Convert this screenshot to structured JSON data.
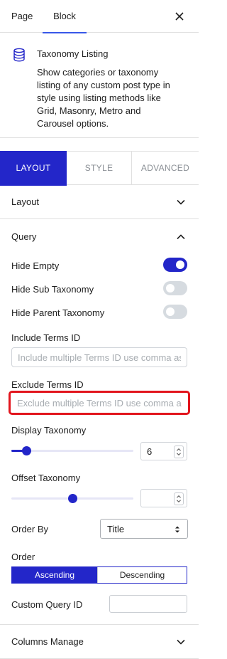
{
  "sidebar_tabs": {
    "page": "Page",
    "block": "Block"
  },
  "block_card": {
    "title": "Taxonomy Listing",
    "description": "Show categories or taxonomy listing of any custom post type in style using listing methods like Grid, Masonry, Metro and Carousel options.",
    "icon": "database-icon"
  },
  "inspector_tabs": {
    "layout": "LAYOUT",
    "style": "STYLE",
    "advanced": "ADVANCED"
  },
  "panels": {
    "layout": "Layout",
    "query": "Query",
    "columns_manage": "Columns Manage"
  },
  "query": {
    "hide_empty": {
      "label": "Hide Empty",
      "enabled": true
    },
    "hide_sub_taxonomy": {
      "label": "Hide Sub Taxonomy",
      "enabled": false
    },
    "hide_parent_taxonomy": {
      "label": "Hide Parent Taxonomy",
      "enabled": false
    },
    "include_terms": {
      "label": "Include Terms ID",
      "placeholder": "Include multiple Terms ID use comma as",
      "value": ""
    },
    "exclude_terms": {
      "label": "Exclude Terms ID",
      "placeholder": "Exclude multiple Terms ID use comma as",
      "value": ""
    },
    "display_taxonomy": {
      "label": "Display Taxonomy",
      "value": "6",
      "slider_fraction": 0.12
    },
    "offset_taxonomy": {
      "label": "Offset Taxonomy",
      "value": "",
      "slider_fraction": 0.5
    },
    "order_by": {
      "label": "Order By",
      "selected": "Title"
    },
    "order": {
      "label": "Order",
      "options": [
        "Ascending",
        "Descending"
      ],
      "selected": "Ascending"
    },
    "custom_query_id": {
      "label": "Custom Query ID",
      "value": ""
    }
  },
  "colors": {
    "accent": "#2326c9",
    "tab_underline": "#3858e9",
    "highlight": "#e2151d"
  }
}
